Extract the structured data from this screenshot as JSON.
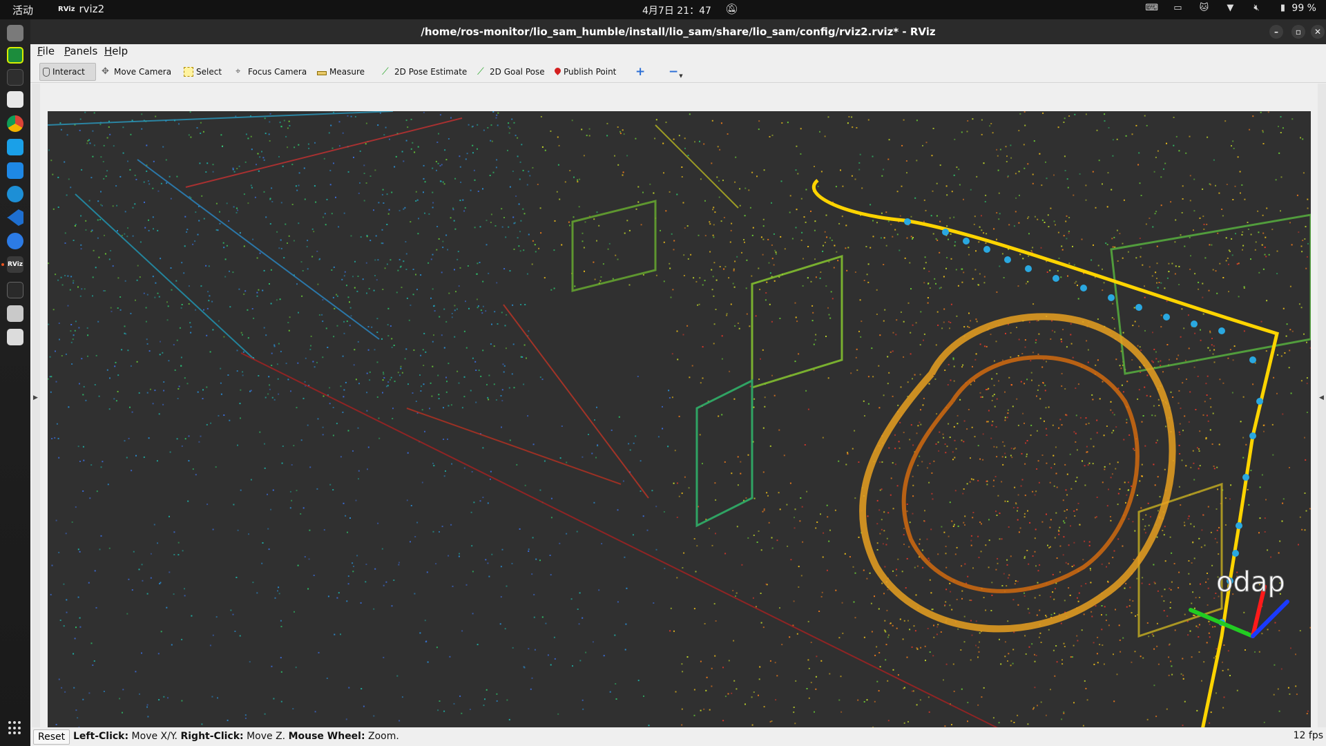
{
  "topbar": {
    "activities": "活动",
    "app_logo": "RViz",
    "app_name": "rviz2",
    "clock": "4月7日 21：47",
    "battery": "99 %",
    "icons": [
      "notification-off-icon",
      "input-method-icon",
      "keyboard-icon",
      "cat-icon",
      "wifi-icon",
      "volume-muted-icon",
      "battery-icon"
    ]
  },
  "dock": {
    "items": [
      "files-icon",
      "pycharm-icon",
      "terminal-icon",
      "text-editor-icon",
      "chrome-icon",
      "multitask-icon",
      "feishu-icon",
      "map-icon",
      "vscode-icon",
      "mail-icon",
      "rviz-icon",
      "system-monitor-icon",
      "document-icon",
      "trash-icon"
    ],
    "apps_grid": "show-apps-icon"
  },
  "window": {
    "title": "/home/ros-monitor/lio_sam_humble/install/lio_sam/share/lio_sam/config/rviz2.rviz* - RViz",
    "controls": {
      "minimize": "–",
      "maximize": "▫",
      "close": "✕"
    }
  },
  "menu": {
    "file": {
      "accel": "F",
      "rest": "ile"
    },
    "panels": {
      "accel": "P",
      "rest": "anels"
    },
    "help": {
      "accel": "H",
      "rest": "elp"
    }
  },
  "toolbar": {
    "interact": "Interact",
    "move_camera": "Move Camera",
    "select": "Select",
    "focus_camera": "Focus Camera",
    "measure": "Measure",
    "pose_estimate": "2D Pose Estimate",
    "goal_pose": "2D Goal Pose",
    "publish_point": "Publish Point",
    "add_tool": "+",
    "remove_tool": "−"
  },
  "view": {
    "background": "#303030",
    "overlay_text": "odap",
    "colors": {
      "trajectory": "#ffd400",
      "axis_x": "#ff1a1a",
      "axis_y": "#22cc22",
      "axis_z": "#1a3aff"
    }
  },
  "status": {
    "reset": "Reset",
    "left_click_label": "Left-Click:",
    "left_click_action": " Move X/Y. ",
    "right_click_label": "Right-Click:",
    "right_click_action": " Move Z. ",
    "wheel_label": "Mouse Wheel:",
    "wheel_action": " Zoom.",
    "fps": "12 fps"
  }
}
